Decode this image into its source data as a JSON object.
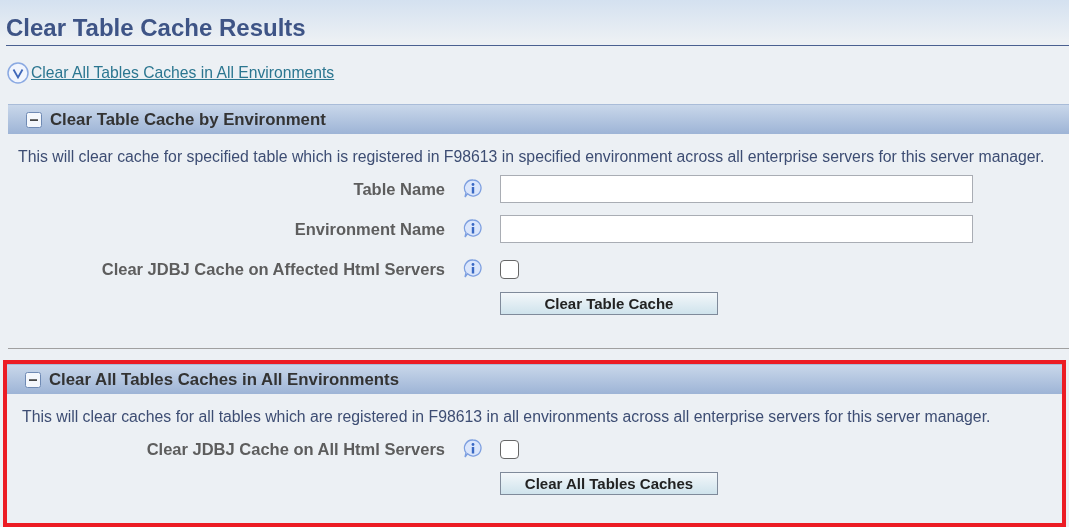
{
  "page_title": "Clear Table Cache Results",
  "jump_link": {
    "label": "Clear All Tables Caches in All Environments"
  },
  "sections": [
    {
      "title": "Clear Table Cache by Environment",
      "expanded": true,
      "highlighted": false,
      "description": "This will clear cache for specified table which is registered in F98613 in specified environment across all enterprise servers for this server manager.",
      "fields": [
        {
          "kind": "text",
          "label": "Table Name"
        },
        {
          "kind": "text",
          "label": "Environment Name"
        },
        {
          "kind": "checkbox",
          "label": "Clear JDBJ Cache on Affected Html Servers",
          "checked": false
        }
      ],
      "button": "Clear Table Cache"
    },
    {
      "title": "Clear All Tables Caches in All Environments",
      "expanded": true,
      "highlighted": true,
      "description": "This will clear caches for all tables which are registered in F98613 in all environments across all enterprise servers for this server manager.",
      "fields": [
        {
          "kind": "checkbox",
          "label": "Clear JDBJ Cache on All Html Servers",
          "checked": false
        }
      ],
      "button": "Clear All Tables Caches"
    }
  ]
}
